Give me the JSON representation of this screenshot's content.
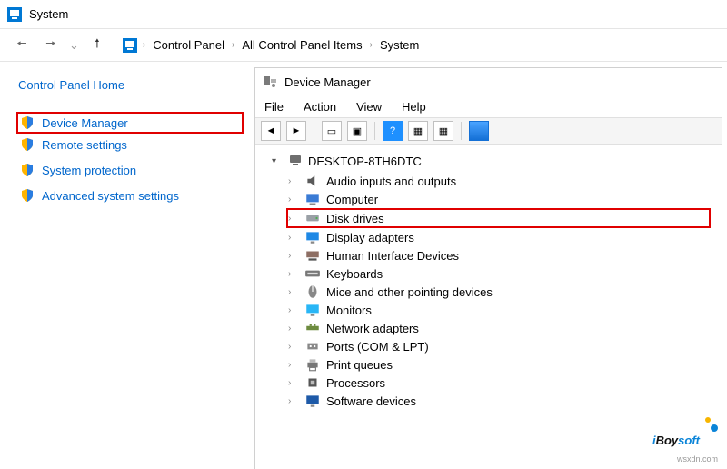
{
  "window": {
    "title": "System"
  },
  "breadcrumbs": {
    "items": [
      "Control Panel",
      "All Control Panel Items",
      "System"
    ]
  },
  "sidebar": {
    "home": "Control Panel Home",
    "links": [
      {
        "label": "Device Manager",
        "highlighted": true
      },
      {
        "label": "Remote settings"
      },
      {
        "label": "System protection"
      },
      {
        "label": "Advanced system settings"
      }
    ]
  },
  "device_manager": {
    "title": "Device Manager",
    "menu": [
      "File",
      "Action",
      "View",
      "Help"
    ],
    "root": "DESKTOP-8TH6DTC",
    "categories": [
      {
        "label": "Audio inputs and outputs",
        "icon": "speaker"
      },
      {
        "label": "Computer",
        "icon": "computer"
      },
      {
        "label": "Disk drives",
        "icon": "disk",
        "highlighted": true
      },
      {
        "label": "Display adapters",
        "icon": "display"
      },
      {
        "label": "Human Interface Devices",
        "icon": "hid"
      },
      {
        "label": "Keyboards",
        "icon": "keyboard"
      },
      {
        "label": "Mice and other pointing devices",
        "icon": "mouse"
      },
      {
        "label": "Monitors",
        "icon": "monitor"
      },
      {
        "label": "Network adapters",
        "icon": "network"
      },
      {
        "label": "Ports (COM & LPT)",
        "icon": "port"
      },
      {
        "label": "Print queues",
        "icon": "printer"
      },
      {
        "label": "Processors",
        "icon": "cpu"
      },
      {
        "label": "Software devices",
        "icon": "software"
      }
    ]
  },
  "watermark": "wsxdn.com",
  "logo": "iBoysoft"
}
